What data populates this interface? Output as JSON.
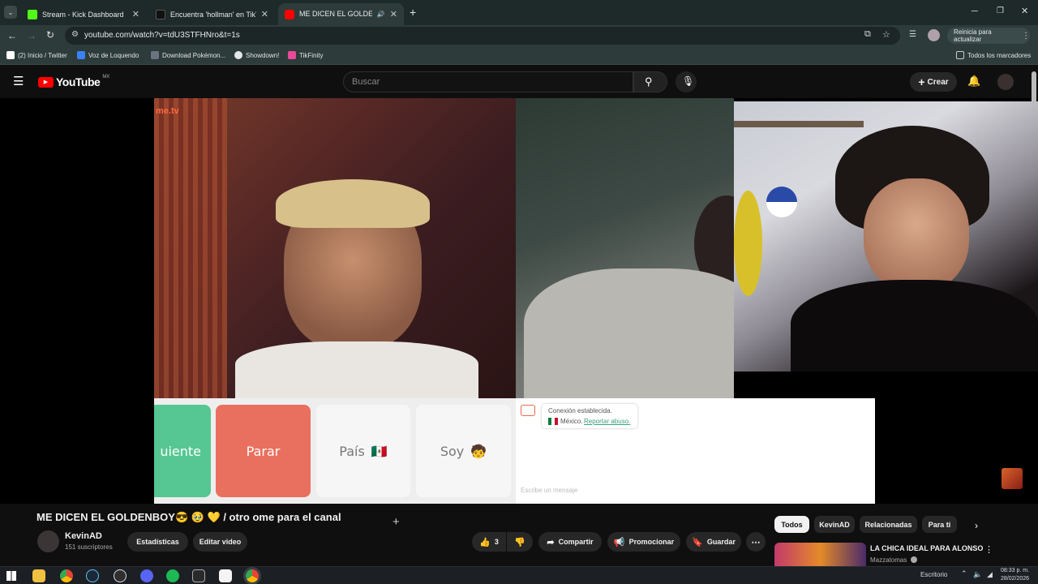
{
  "browser": {
    "tabs": [
      {
        "title": "Stream - Kick Dashboard",
        "color": "#53fc18"
      },
      {
        "title": "Encuentra 'hollman' en TikTok |",
        "color": "#111111"
      },
      {
        "title": "ME DICEN EL GOLDENBOY😎",
        "color": "#ff0000"
      }
    ],
    "new_tab_label": "+",
    "url": "youtube.com/watch?v=tdU3STFHNro&t=1s",
    "update_label": "Reinicia para actualizar",
    "bookmarks": [
      {
        "label": "(2) Inicio / Twitter",
        "color": "#ffffff"
      },
      {
        "label": "Voz de Loquendo",
        "color": "#3b82f6"
      },
      {
        "label": "Download Pokémon...",
        "color": "#6b7280"
      },
      {
        "label": "Showdown!",
        "color": "#e5e7eb"
      },
      {
        "label": "TikFinity",
        "color": "#ec4899"
      }
    ],
    "all_bookmarks_label": "Todos los marcadores"
  },
  "youtube": {
    "logo_text": "YouTube",
    "region": "MX",
    "search_placeholder": "Buscar",
    "create_label": "Crear"
  },
  "video": {
    "watermark": "me.tv",
    "buttons": {
      "next": "uiente",
      "stop": "Parar",
      "country": "País",
      "country_flag": "🇲🇽",
      "me": "Soy",
      "me_emoji": "🧒"
    },
    "chat": {
      "status": "Conexión establecida.",
      "country": "México.",
      "report": "Reportar abuso.",
      "placeholder": "Escribe un mensaje"
    }
  },
  "details": {
    "title": "ME DICEN EL GOLDENBOY😎 🥹 💛 / otro ome para el canal",
    "channel": "KevinAD",
    "subscribers": "151 suscriptores",
    "stats_label": "Estadísticas",
    "edit_label": "Editar video",
    "likes": "3",
    "share_label": "Compartir",
    "promote_label": "Promocionar",
    "save_label": "Guardar"
  },
  "sidebar": {
    "chips": [
      "Todos",
      "KevinAD",
      "Relacionadas",
      "Para ti"
    ],
    "rec_title": "LA CHICA IDEAL PARA ALONSO",
    "rec_channel": "Mazzatomas"
  },
  "taskbar": {
    "desktop_label": "Escritorio",
    "time": "08:33 p. m.",
    "date": "28/02/2026"
  }
}
